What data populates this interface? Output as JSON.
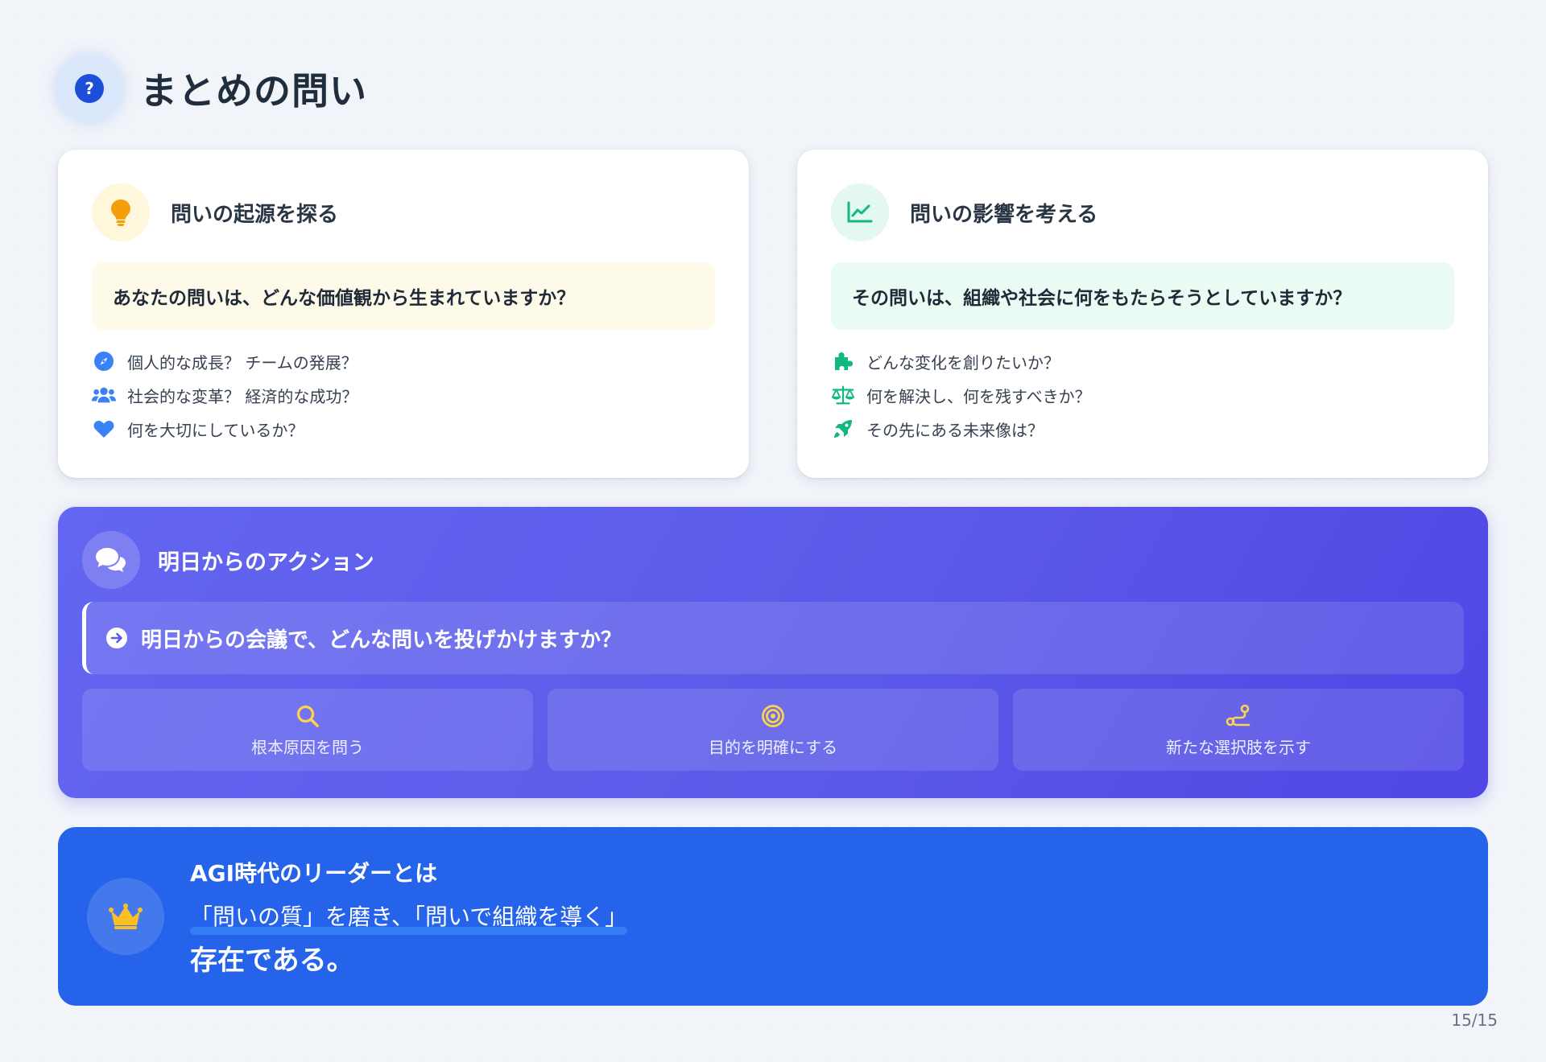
{
  "title": "まとめの問い",
  "cards": [
    {
      "title": "問いの起源を探る",
      "question": "あなたの問いは、どんな価値観から生まれていますか？",
      "items": [
        {
          "icon": "compass-icon",
          "text": "個人的な成長？ チームの発展？"
        },
        {
          "icon": "users-icon",
          "text": "社会的な変革？ 経済的な成功？"
        },
        {
          "icon": "heart-icon",
          "text": "何を大切にしているか？"
        }
      ]
    },
    {
      "title": "問いの影響を考える",
      "question": "その問いは、組織や社会に何をもたらそうとしていますか？",
      "items": [
        {
          "icon": "puzzle-icon",
          "text": "どんな変化を創りたいか？"
        },
        {
          "icon": "scale-icon",
          "text": "何を解決し、何を残すべきか？"
        },
        {
          "icon": "rocket-icon",
          "text": "その先にある未来像は？"
        }
      ]
    }
  ],
  "action": {
    "title": "明日からのアクション",
    "question": "明日からの会議で、どんな問いを投げかけますか？",
    "tiles": [
      {
        "icon": "search-icon",
        "label": "根本原因を問う"
      },
      {
        "icon": "target-icon",
        "label": "目的を明確にする"
      },
      {
        "icon": "route-icon",
        "label": "新たな選択肢を示す"
      }
    ]
  },
  "leader": {
    "line1": "AGI時代のリーダーとは",
    "line2": "「問いの質」を磨き、「問いで組織を導く」",
    "line3": "存在である。"
  },
  "page_number": "15/15",
  "colors": {
    "accent_blue": "#2563eb",
    "indigo": "#5b5ae8",
    "yellow_icon": "#f59e0b",
    "green_icon": "#10b981",
    "list_blue": "#3b82f6"
  }
}
